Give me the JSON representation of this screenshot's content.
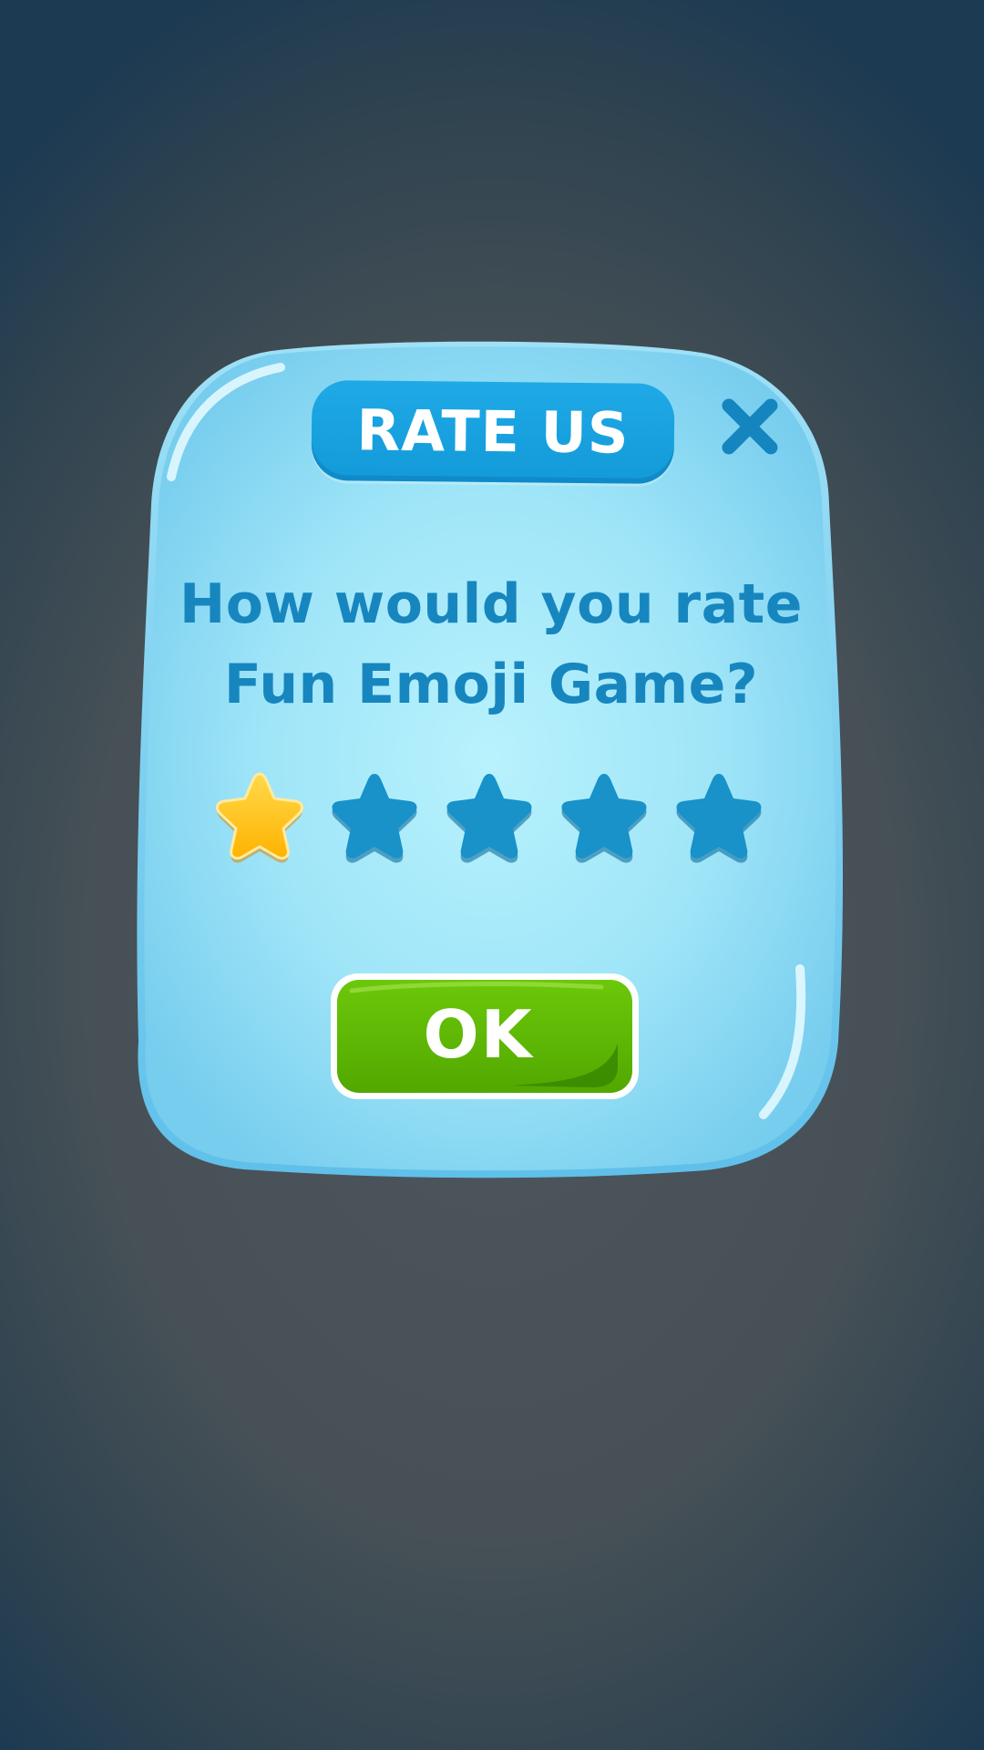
{
  "dialog": {
    "title": "RATE US",
    "question_line1": "How would you rate",
    "question_line2": "Fun Emoji Game?",
    "ok_label": "OK"
  },
  "rating": {
    "value": 1,
    "max": 5
  },
  "colors": {
    "panel": "#8fdcf5",
    "panel_center": "#b4f0fc",
    "title_pill": "#17a0dd",
    "accent_blue": "#1786bf",
    "star_empty": "#1892c9",
    "star_filled": "#ffc629",
    "ok_green": "#5cb500",
    "background": "#465056"
  },
  "icons": {
    "close": "close-icon",
    "star": "star-icon"
  }
}
